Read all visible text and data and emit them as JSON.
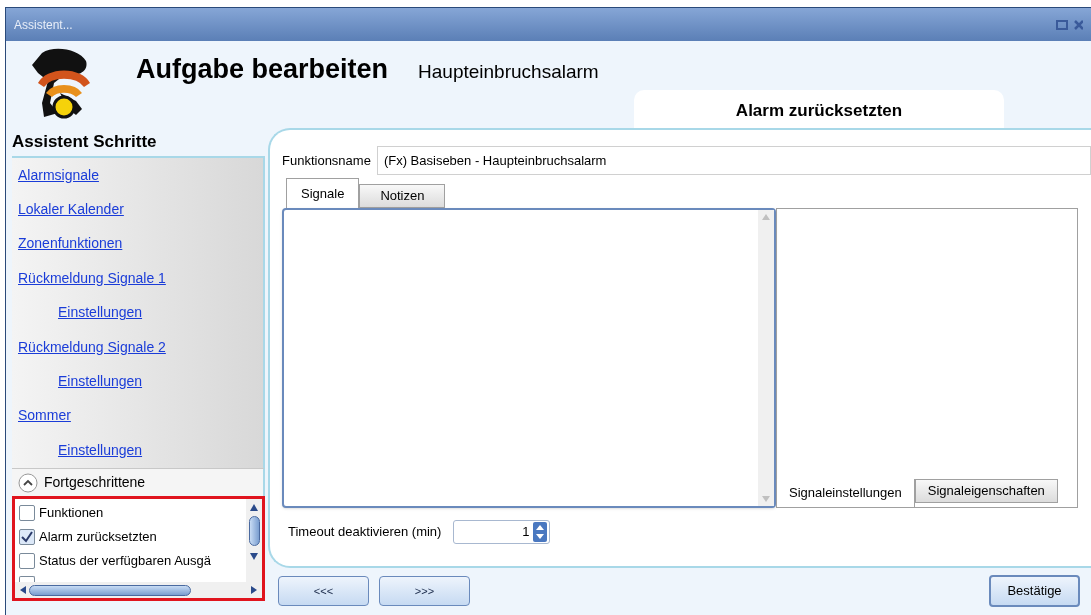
{
  "window": {
    "title": "Assistent..."
  },
  "header": {
    "title": "Aufgabe bearbeiten",
    "subtitle": "Haupteinbruchsalarm",
    "page_tab": "Alarm zurücksetzten"
  },
  "sidebar": {
    "title": "Assistent Schritte",
    "steps": [
      {
        "label": "Alarmsignale"
      },
      {
        "label": "Lokaler Kalender"
      },
      {
        "label": "Zonenfunktionen"
      },
      {
        "label": "Rückmeldung Signale 1",
        "children": [
          {
            "label": "Einstellungen"
          }
        ]
      },
      {
        "label": "Rückmeldung Signale 2",
        "children": [
          {
            "label": "Einstellungen"
          }
        ]
      },
      {
        "label": "Sommer",
        "children": [
          {
            "label": "Einstellungen"
          }
        ]
      }
    ],
    "advanced": {
      "label": "Fortgeschrittene",
      "expanded": true,
      "items": [
        {
          "label": "Funktionen",
          "checked": false
        },
        {
          "label": "Alarm zurücksetzten",
          "checked": true
        },
        {
          "label": "Status der verfügbaren Ausgä",
          "checked": false
        }
      ]
    }
  },
  "form": {
    "function_name_label": "Funktionsname",
    "function_name": "(Fx) Basiseben - Haupteinbruchsalarm",
    "tabs": [
      {
        "label": "Signale",
        "selected": true
      },
      {
        "label": "Notizen",
        "selected": false
      }
    ],
    "side_tabs": [
      {
        "label": "Signaleinstellungen",
        "selected": true
      },
      {
        "label": "Signaleigenschaften",
        "selected": false
      }
    ],
    "timeout_label": "Timeout deaktivieren (min)",
    "timeout_value": "1"
  },
  "footer": {
    "back": "<<<",
    "next": ">>>",
    "confirm": "Bestätige"
  }
}
